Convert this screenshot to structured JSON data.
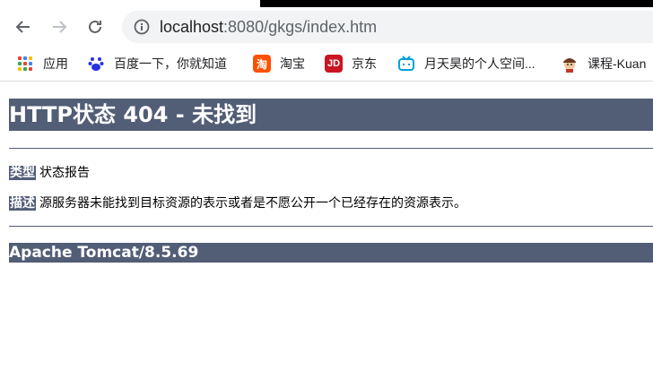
{
  "browser": {
    "url_host": "localhost",
    "url_rest": ":8080/gkgs/index.htm"
  },
  "bookmarks": [
    {
      "label": "应用",
      "icon": "apps-grid-icon"
    },
    {
      "label": "百度一下，你就知道",
      "icon": "baidu-paw-icon"
    },
    {
      "label": "淘宝",
      "icon": "taobao-icon",
      "icon_text": "淘"
    },
    {
      "label": "京东",
      "icon": "jd-icon",
      "icon_text": "JD"
    },
    {
      "label": "月天昊的个人空间...",
      "icon": "bilibili-tv-icon"
    },
    {
      "label": "课程-Kuan",
      "icon": "avatar-icon"
    }
  ],
  "page": {
    "heading": "HTTP状态 404 - 未找到",
    "type_label": "类型",
    "type_value": "状态报告",
    "desc_label": "描述",
    "desc_value": "源服务器未能找到目标资源的表示或者是不愿公开一个已经存在的资源表示。",
    "footer": "Apache Tomcat/8.5.69"
  },
  "colors": {
    "tomcat_bar": "#525d76",
    "omnibox_bg": "#f1f3f4"
  }
}
